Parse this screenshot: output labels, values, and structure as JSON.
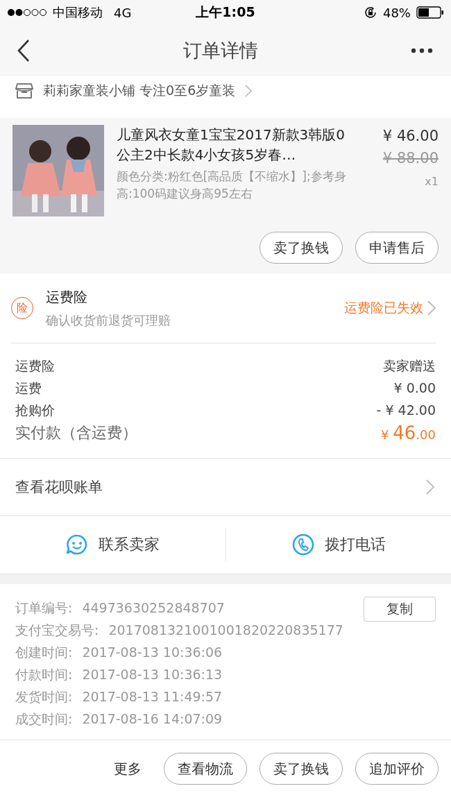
{
  "status_bar": {
    "carrier": "中国移动",
    "network": "4G",
    "time": "上午1:05",
    "battery": "48%"
  },
  "nav": {
    "title": "订单详情"
  },
  "shop": {
    "name": "莉莉家童装小铺 专注0至6岁童装"
  },
  "product": {
    "kind": "picture",
    "title": "儿童风衣女童1宝宝2017新款3韩版0公主2中长款4小女孩5岁春…",
    "sku": "颜色分类:粉红色[高品质【不缩水】];参考身高:100码建议身高95左右",
    "price": "¥ 46.00",
    "original_price": "¥ 88.00",
    "quantity": "x1",
    "buttons": [
      "卖了换钱",
      "申请售后"
    ]
  },
  "insurance": {
    "badge": "险",
    "title": "运费险",
    "subtitle": "确认收货前退货可理赔",
    "status": "运费险已失效"
  },
  "fees": [
    {
      "label": "运费险",
      "value": "卖家赠送"
    },
    {
      "label": "运费",
      "value": "¥ 0.00"
    },
    {
      "label": "抢购价",
      "value": "- ¥ 42.00"
    }
  ],
  "total": {
    "label": "实付款（含运费）",
    "currency": "¥ ",
    "integer": "46",
    "decimal": ".00"
  },
  "huabei": {
    "label": "查看花呗账单"
  },
  "contact": [
    {
      "kind": "chat",
      "label": "联系卖家"
    },
    {
      "kind": "phone",
      "label": "拨打电话"
    }
  ],
  "order_info": {
    "copy_button": "复制",
    "rows": [
      {
        "label": "订单编号:",
        "value": "44973630252848707"
      },
      {
        "label": "支付宝交易号:",
        "value": "2017081321001001820220835177"
      },
      {
        "label": "创建时间:",
        "value": "2017-08-13 10:36:06"
      },
      {
        "label": "付款时间:",
        "value": "2017-08-13 10:36:13"
      },
      {
        "label": "发货时间:",
        "value": "2017-08-13 11:49:57"
      },
      {
        "label": "成交时间:",
        "value": "2017-08-16 14:07:09"
      }
    ]
  },
  "bottom_bar": {
    "more": "更多",
    "buttons": [
      "查看物流",
      "卖了换钱",
      "追加评价"
    ]
  }
}
